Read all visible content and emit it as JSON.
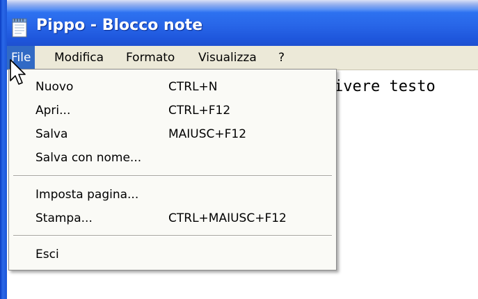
{
  "window": {
    "title": "Pippo - Blocco note"
  },
  "menubar": {
    "items": [
      {
        "label": "File"
      },
      {
        "label": "Modifica"
      },
      {
        "label": "Formato"
      },
      {
        "label": "Visualizza"
      },
      {
        "label": "?"
      }
    ]
  },
  "editor": {
    "visible_text": "ivere testo"
  },
  "file_menu": {
    "items": [
      {
        "label": "Nuovo",
        "shortcut": "CTRL+N"
      },
      {
        "label": "Apri...",
        "shortcut": "CTRL+F12"
      },
      {
        "label": "Salva",
        "shortcut": "MAIUSC+F12"
      },
      {
        "label": "Salva con nome...",
        "shortcut": ""
      },
      {
        "label": "Imposta pagina...",
        "shortcut": ""
      },
      {
        "label": "Stampa...",
        "shortcut": "CTRL+MAIUSC+F12"
      },
      {
        "label": "Esci",
        "shortcut": ""
      }
    ]
  },
  "colors": {
    "titlebar": "#2866e8",
    "menubar": "#ece9d8",
    "menu_highlight": "#316ac5"
  },
  "icons": {
    "app": "notepad-icon",
    "pointer": "mouse-pointer-icon"
  }
}
